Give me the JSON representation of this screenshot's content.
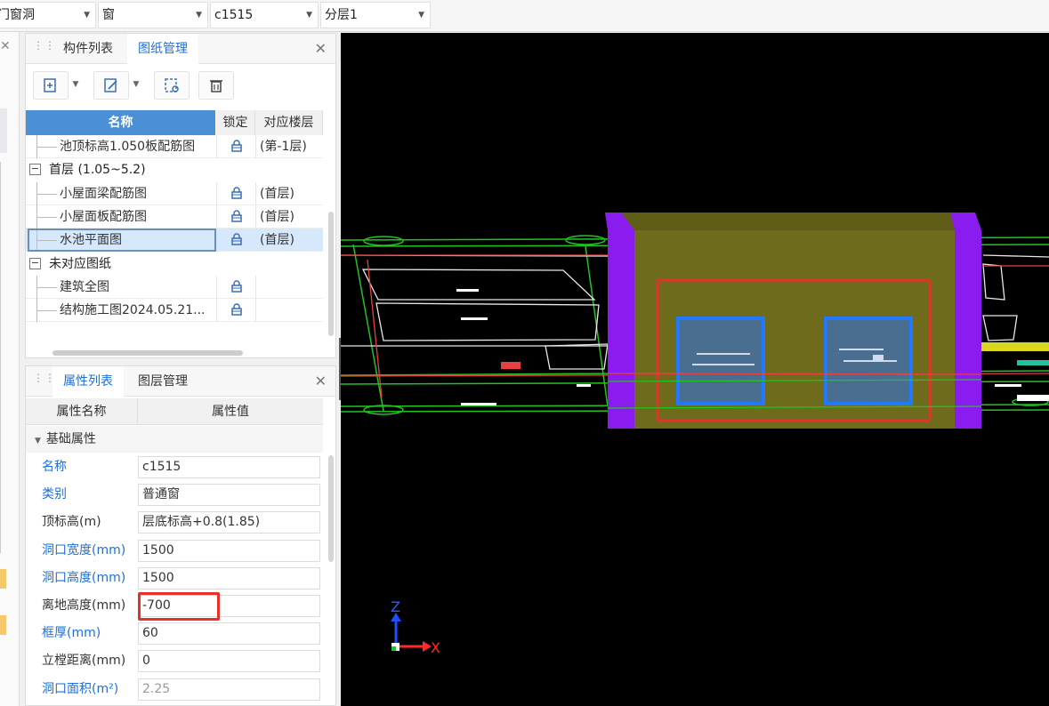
{
  "topbar": {
    "combos": [
      {
        "value": "门窗洞"
      },
      {
        "value": "窗"
      },
      {
        "value": "c1515"
      },
      {
        "value": "分层1"
      }
    ]
  },
  "drawing_panel": {
    "tabs": [
      {
        "label": "构件列表",
        "active": false
      },
      {
        "label": "图纸管理",
        "active": true
      }
    ],
    "columns": {
      "name": "名称",
      "lock": "锁定",
      "floor": "对应楼层"
    },
    "rows": [
      {
        "type": "item",
        "name": "池顶标高1.050板配筋图",
        "floor": "(第-1层)"
      },
      {
        "type": "group",
        "name": "首层 (1.05~5.2)"
      },
      {
        "type": "item",
        "name": "小屋面梁配筋图",
        "floor": "(首层)"
      },
      {
        "type": "item",
        "name": "小屋面板配筋图",
        "floor": "(首层)"
      },
      {
        "type": "item",
        "name": "水池平面图",
        "floor": "(首层)",
        "selected": true
      },
      {
        "type": "group",
        "name": "未对应图纸"
      },
      {
        "type": "item",
        "name": "建筑全图",
        "floor": ""
      },
      {
        "type": "item",
        "name": "结构施工图2024.05.21...",
        "floor": ""
      }
    ]
  },
  "property_panel": {
    "tabs": [
      {
        "label": "属性列表",
        "active": true
      },
      {
        "label": "图层管理",
        "active": false
      }
    ],
    "columns": {
      "key": "属性名称",
      "value": "属性值"
    },
    "section": "基础属性",
    "rows": [
      {
        "key": "名称",
        "value": "c1515",
        "blue": true
      },
      {
        "key": "类别",
        "value": "普通窗",
        "blue": true
      },
      {
        "key": "顶标高(m)",
        "value": "层底标高+0.8(1.85)",
        "blue": false
      },
      {
        "key": "洞口宽度(mm)",
        "value": "1500",
        "blue": true
      },
      {
        "key": "洞口高度(mm)",
        "value": "1500",
        "blue": true
      },
      {
        "key": "离地高度(mm)",
        "value": "-700",
        "blue": false,
        "highlight": true
      },
      {
        "key": "框厚(mm)",
        "value": "60",
        "blue": true
      },
      {
        "key": "立樘距离(mm)",
        "value": "0",
        "blue": false
      },
      {
        "key": "洞口面积(m²)",
        "value": "2.25",
        "blue": true,
        "disabled": true
      }
    ]
  },
  "viewport": {
    "axis_z": "Z",
    "axis_x": "X"
  },
  "colors": {
    "accent": "#1e6fd9",
    "highlight_red": "#e8302a",
    "wall_olive": "#6e6b1c",
    "column_purple": "#8b1cf0",
    "window_blue": "#4a6e8f",
    "cad_green": "#22c322"
  }
}
